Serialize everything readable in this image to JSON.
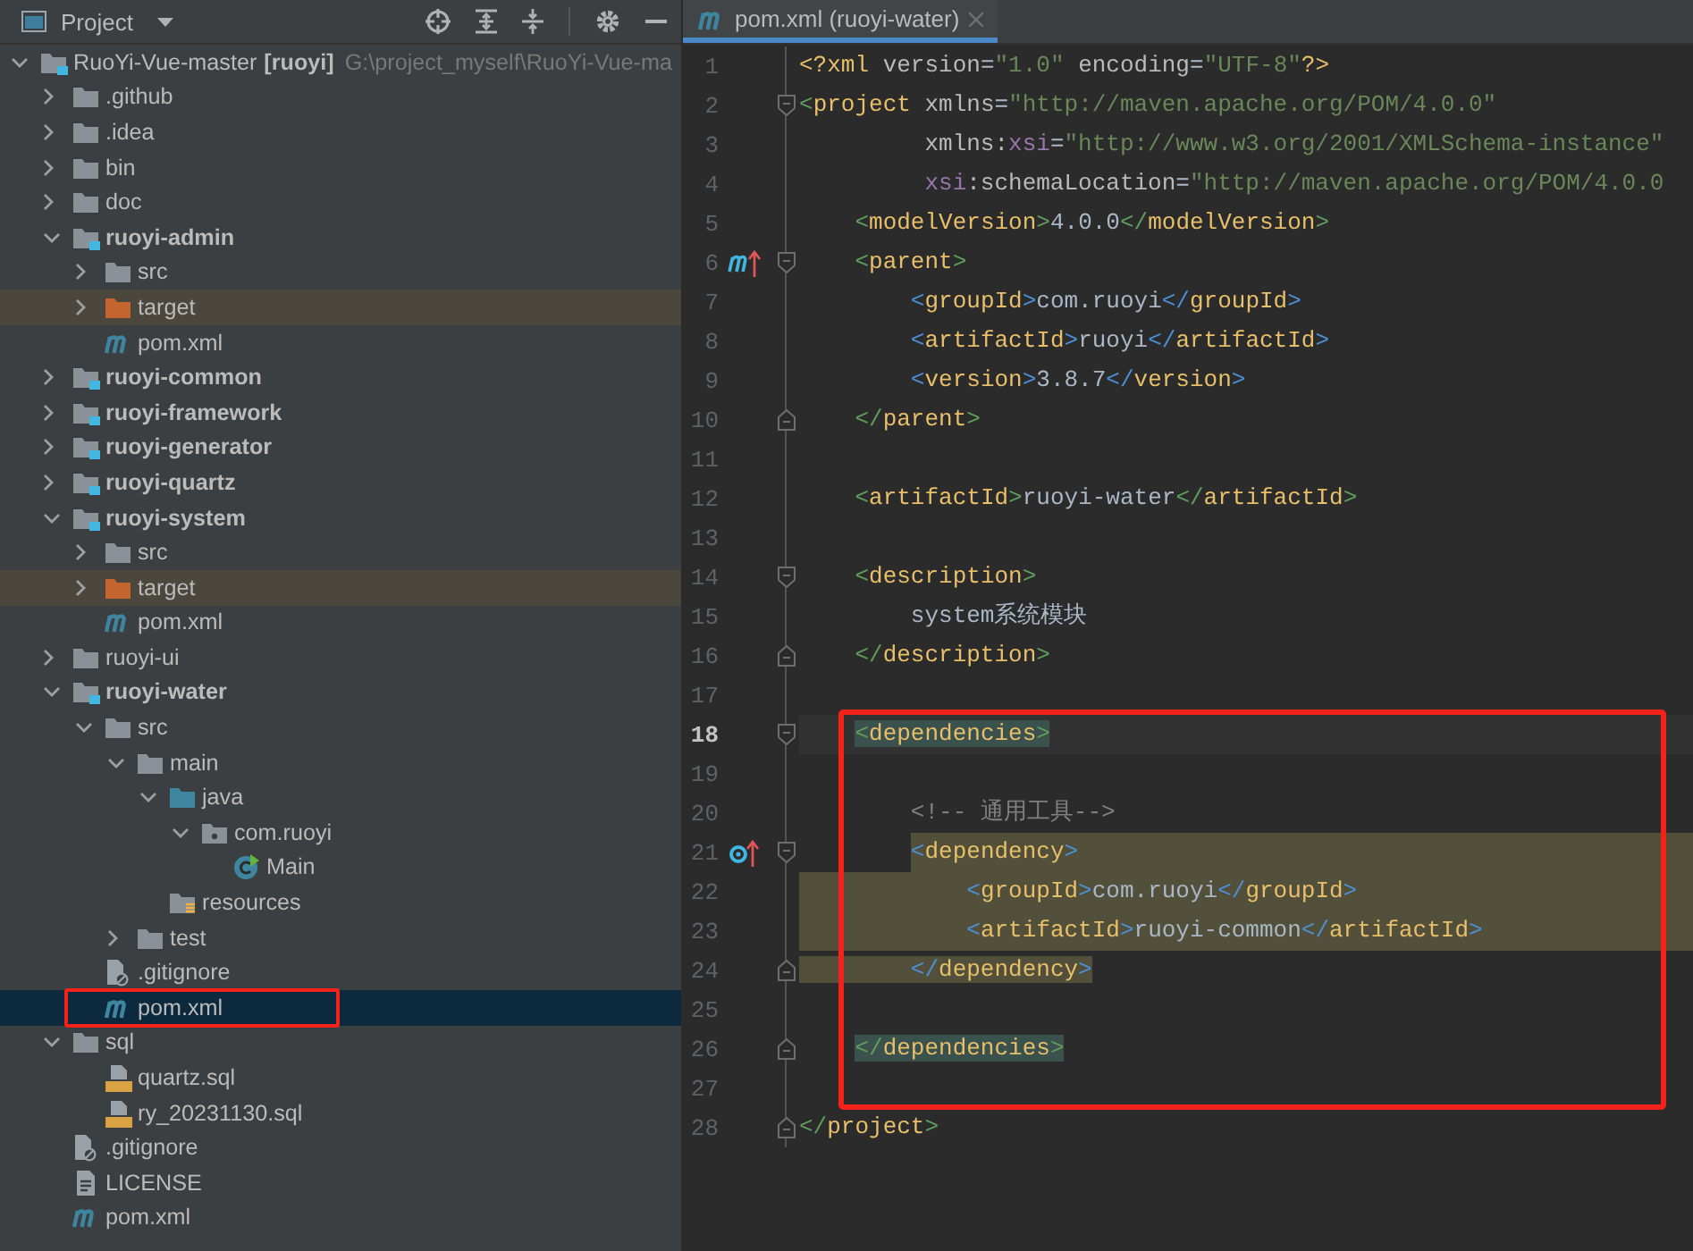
{
  "panel": {
    "title": "Project"
  },
  "tree": {
    "label": "RuoYi-Vue-master",
    "tag": "[ruoyi]",
    "path": "G:\\project_myself\\RuoYi-Vue-ma",
    "kind": "module",
    "expanded": true,
    "selected": false,
    "marked": false,
    "children": [
      {
        "label": ".github",
        "kind": "folder",
        "expanded": false,
        "selected": false,
        "marked": false
      },
      {
        "label": ".idea",
        "kind": "folder",
        "expanded": false,
        "selected": false,
        "marked": false
      },
      {
        "label": "bin",
        "kind": "folder",
        "expanded": false,
        "selected": false,
        "marked": false
      },
      {
        "label": "doc",
        "kind": "folder",
        "expanded": false,
        "selected": false,
        "marked": false
      },
      {
        "label": "ruoyi-admin",
        "kind": "module",
        "expanded": true,
        "selected": false,
        "marked": false,
        "children": [
          {
            "label": "src",
            "kind": "folder",
            "expanded": false,
            "selected": false,
            "marked": false
          },
          {
            "label": "target",
            "kind": "excluded",
            "expanded": false,
            "selected": false,
            "marked": false
          },
          {
            "label": "pom.xml",
            "kind": "maven",
            "selected": false,
            "marked": false
          }
        ]
      },
      {
        "label": "ruoyi-common",
        "kind": "module",
        "expanded": false,
        "selected": false,
        "marked": false
      },
      {
        "label": "ruoyi-framework",
        "kind": "module",
        "expanded": false,
        "selected": false,
        "marked": false
      },
      {
        "label": "ruoyi-generator",
        "kind": "module",
        "expanded": false,
        "selected": false,
        "marked": false
      },
      {
        "label": "ruoyi-quartz",
        "kind": "module",
        "expanded": false,
        "selected": false,
        "marked": false
      },
      {
        "label": "ruoyi-system",
        "kind": "module",
        "expanded": true,
        "selected": false,
        "marked": false,
        "children": [
          {
            "label": "src",
            "kind": "folder",
            "expanded": false,
            "selected": false,
            "marked": false
          },
          {
            "label": "target",
            "kind": "excluded",
            "expanded": false,
            "selected": false,
            "marked": false
          },
          {
            "label": "pom.xml",
            "kind": "maven",
            "selected": false,
            "marked": false
          }
        ]
      },
      {
        "label": "ruoyi-ui",
        "kind": "folder",
        "expanded": false,
        "selected": false,
        "marked": false
      },
      {
        "label": "ruoyi-water",
        "kind": "module",
        "expanded": true,
        "selected": false,
        "marked": false,
        "children": [
          {
            "label": "src",
            "kind": "folder",
            "expanded": true,
            "selected": false,
            "marked": false,
            "children": [
              {
                "label": "main",
                "kind": "folder",
                "expanded": true,
                "selected": false,
                "marked": false,
                "children": [
                  {
                    "label": "java",
                    "kind": "source-root",
                    "expanded": true,
                    "selected": false,
                    "marked": false,
                    "children": [
                      {
                        "label": "com.ruoyi",
                        "kind": "package",
                        "expanded": true,
                        "selected": false,
                        "marked": false,
                        "children": [
                          {
                            "label": "Main",
                            "kind": "class",
                            "selected": false,
                            "marked": false
                          }
                        ]
                      }
                    ]
                  },
                  {
                    "label": "resources",
                    "kind": "resources",
                    "selected": false,
                    "marked": false
                  }
                ]
              },
              {
                "label": "test",
                "kind": "folder",
                "expanded": false,
                "selected": false,
                "marked": false
              }
            ]
          },
          {
            "label": ".gitignore",
            "kind": "ignore",
            "selected": false,
            "marked": false
          },
          {
            "label": "pom.xml",
            "kind": "maven",
            "selected": true,
            "marked": true
          }
        ]
      },
      {
        "label": "sql",
        "kind": "folder",
        "expanded": true,
        "selected": false,
        "marked": false,
        "children": [
          {
            "label": "quartz.sql",
            "kind": "sql",
            "selected": false,
            "marked": false
          },
          {
            "label": "ry_20231130.sql",
            "kind": "sql",
            "selected": false,
            "marked": false
          }
        ]
      },
      {
        "label": ".gitignore",
        "kind": "ignore",
        "selected": false,
        "marked": false
      },
      {
        "label": "LICENSE",
        "kind": "text",
        "selected": false,
        "marked": false
      },
      {
        "label": "pom.xml",
        "kind": "maven",
        "selected": false,
        "marked": false
      }
    ]
  },
  "editor": {
    "tab": {
      "label": "pom.xml (ruoyi-water)",
      "selected": true
    },
    "lines": [
      {
        "number": "1",
        "kind": "plain",
        "selected": false,
        "marked": false,
        "text": "<?xml version=\"1.0\" encoding=\"UTF-8\"?>"
      },
      {
        "number": "2",
        "kind": "plain",
        "selected": false,
        "marked": false,
        "text": "<project xmlns=\"http://maven.apache.org/POM/4.0.0\""
      },
      {
        "number": "3",
        "kind": "plain",
        "selected": false,
        "marked": false,
        "text": "         xmlns:xsi=\"http://www.w3.org/2001/XMLSchema-instance\""
      },
      {
        "number": "4",
        "kind": "plain",
        "selected": false,
        "marked": false,
        "text": "         xsi:schemaLocation=\"http://maven.apache.org/POM/4.0.0"
      },
      {
        "number": "5",
        "kind": "plain",
        "selected": false,
        "marked": false,
        "text": "    <modelVersion>4.0.0</modelVersion>"
      },
      {
        "number": "6",
        "kind": "parent-ref",
        "selected": false,
        "marked": false,
        "text": "    <parent>"
      },
      {
        "number": "7",
        "kind": "plain",
        "selected": false,
        "marked": false,
        "text": "        <groupId>com.ruoyi</groupId>"
      },
      {
        "number": "8",
        "kind": "plain",
        "selected": false,
        "marked": false,
        "text": "        <artifactId>ruoyi</artifactId>"
      },
      {
        "number": "9",
        "kind": "plain",
        "selected": false,
        "marked": false,
        "text": "        <version>3.8.7</version>"
      },
      {
        "number": "10",
        "kind": "plain",
        "selected": false,
        "marked": false,
        "text": "    </parent>"
      },
      {
        "number": "11",
        "kind": "plain",
        "selected": false,
        "marked": false
      },
      {
        "number": "12",
        "kind": "plain",
        "selected": false,
        "marked": false,
        "text": "    <artifactId>ruoyi-water</artifactId>"
      },
      {
        "number": "13",
        "kind": "plain",
        "selected": false,
        "marked": false
      },
      {
        "number": "14",
        "kind": "plain",
        "selected": false,
        "marked": false,
        "text": "    <description>"
      },
      {
        "number": "15",
        "kind": "plain",
        "selected": false,
        "marked": false,
        "text": "        system系统模块"
      },
      {
        "number": "16",
        "kind": "plain",
        "selected": false,
        "marked": false,
        "text": "    </description>"
      },
      {
        "number": "17",
        "kind": "plain",
        "selected": false,
        "marked": false
      },
      {
        "number": "18",
        "kind": "plain",
        "selected": true,
        "marked": true,
        "text": "    <dependencies>"
      },
      {
        "number": "19",
        "kind": "plain",
        "selected": false,
        "marked": true
      },
      {
        "number": "20",
        "kind": "plain",
        "selected": false,
        "marked": true,
        "text": "        <!-- 通用工具-->"
      },
      {
        "number": "21",
        "kind": "dependency-ref",
        "selected": false,
        "marked": true,
        "text": "        <dependency>"
      },
      {
        "number": "22",
        "kind": "highlighted",
        "selected": false,
        "marked": true,
        "text": "            <groupId>com.ruoyi</groupId>"
      },
      {
        "number": "23",
        "kind": "highlighted",
        "selected": false,
        "marked": true,
        "text": "            <artifactId>ruoyi-common</artifactId>"
      },
      {
        "number": "24",
        "kind": "highlighted-end",
        "selected": false,
        "marked": true,
        "text": "        </dependency>"
      },
      {
        "number": "25",
        "kind": "plain",
        "selected": false,
        "marked": true
      },
      {
        "number": "26",
        "kind": "plain",
        "selected": false,
        "marked": true,
        "text": "    </dependencies>"
      },
      {
        "number": "27",
        "kind": "plain",
        "selected": false,
        "marked": true
      },
      {
        "number": "28",
        "kind": "plain",
        "selected": false,
        "marked": false,
        "text": "</project>"
      }
    ]
  }
}
